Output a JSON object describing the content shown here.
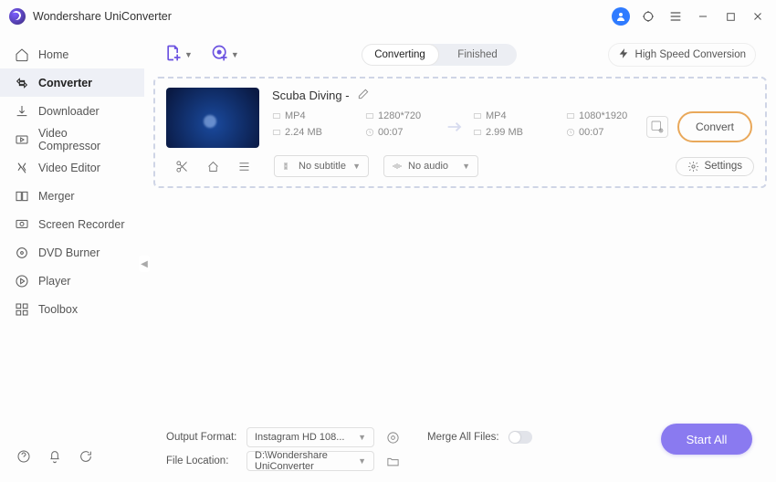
{
  "app": {
    "title": "Wondershare UniConverter"
  },
  "sidebar": {
    "items": [
      {
        "label": "Home"
      },
      {
        "label": "Converter"
      },
      {
        "label": "Downloader"
      },
      {
        "label": "Video Compressor"
      },
      {
        "label": "Video Editor"
      },
      {
        "label": "Merger"
      },
      {
        "label": "Screen Recorder"
      },
      {
        "label": "DVD Burner"
      },
      {
        "label": "Player"
      },
      {
        "label": "Toolbox"
      }
    ]
  },
  "tabs": {
    "converting": "Converting",
    "finished": "Finished"
  },
  "high_speed": "High Speed Conversion",
  "file": {
    "name": "Scuba Diving -",
    "src": {
      "format": "MP4",
      "res": "1280*720",
      "size": "2.24 MB",
      "dur": "00:07"
    },
    "dst": {
      "format": "MP4",
      "res": "1080*1920",
      "size": "2.99 MB",
      "dur": "00:07"
    },
    "subtitle": "No subtitle",
    "audio": "No audio",
    "settings": "Settings",
    "convert": "Convert"
  },
  "footer": {
    "output_label": "Output Format:",
    "output_value": "Instagram HD 108...",
    "merge_label": "Merge All Files:",
    "location_label": "File Location:",
    "location_value": "D:\\Wondershare UniConverter"
  },
  "start_all": "Start All"
}
